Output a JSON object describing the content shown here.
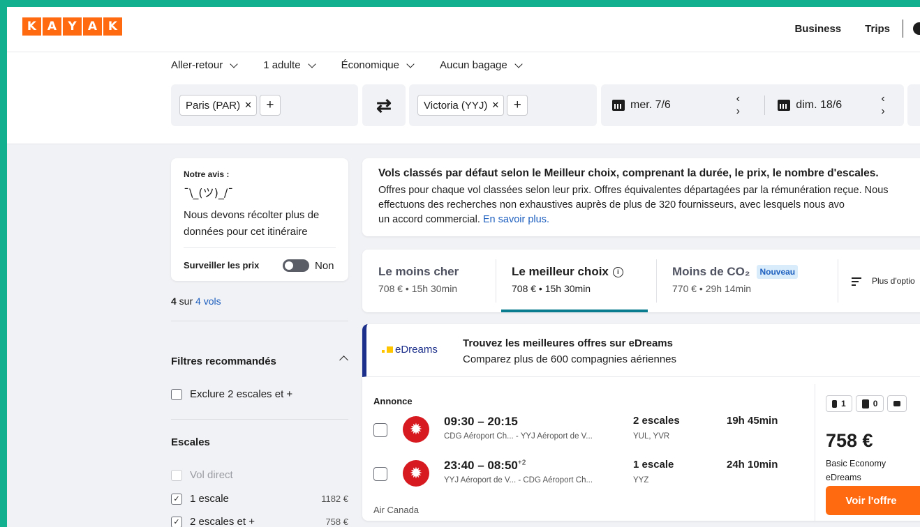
{
  "header": {
    "logo_letters": [
      "K",
      "A",
      "Y",
      "A",
      "K"
    ],
    "nav": {
      "business": "Business",
      "trips": "Trips"
    }
  },
  "search": {
    "options": [
      "Aller-retour",
      "1 adulte",
      "Économique",
      "Aucun bagage"
    ],
    "origin": "Paris (PAR)",
    "destination": "Victoria (YYJ)",
    "depart_date": "mer. 7/6",
    "return_date": "dim. 18/6",
    "remove_glyph": "✕",
    "add_glyph": "+",
    "swap_glyph": "⇄",
    "date_arrows": "‹ ›"
  },
  "advice": {
    "label": "Notre avis :",
    "shrug": "¯\\_(ツ)_/¯",
    "message": "Nous devons récolter plus de données pour cet itinéraire",
    "watch_label": "Surveiller les prix",
    "toggle_state": "Non"
  },
  "results_count": {
    "count": "4",
    "sep": " sur ",
    "total": "4 vols"
  },
  "filters": {
    "recommended_title": "Filtres recommandés",
    "recommended": [
      {
        "label": "Exclure 2 escales et +",
        "checked": false
      }
    ],
    "stops_title": "Escales",
    "stops": [
      {
        "label": "Vol direct",
        "price": "",
        "checked": false,
        "disabled": true
      },
      {
        "label": "1 escale",
        "price": "1182 €",
        "checked": true,
        "disabled": false
      },
      {
        "label": "2 escales et +",
        "price": "758 €",
        "checked": true,
        "disabled": false
      }
    ]
  },
  "info_banner": {
    "title": "Vols classés par défaut selon le Meilleur choix, comprenant la durée, le prix, le nombre d'escales.",
    "body": "Offres pour chaque vol classées selon leur prix. Offres équivalentes départagées par la rémunération reçue. Nous effectuons des recherches non exhaustives auprès de plus de 320 fournisseurs, avec lesquels nous avo",
    "body_end": "un accord commercial. ",
    "link": "En savoir plus."
  },
  "sort_tabs": [
    {
      "name": "Le moins cher",
      "sub": "708 € • 15h 30min",
      "active": false
    },
    {
      "name": "Le meilleur choix",
      "sub": "708 € • 15h 30min",
      "active": true
    },
    {
      "name": "Moins de CO₂",
      "sub": "770 € • 29h 14min",
      "active": false,
      "badge": "Nouveau"
    }
  ],
  "sort_more": "Plus d'optio",
  "info_icon": "i",
  "ad": {
    "brand": "eDreams",
    "headline": "Trouvez les meilleures offres sur eDreams",
    "subline": "Comparez plus de 600 compagnies aériennes",
    "label": "Annonce",
    "airline": "Air Canada",
    "legs": [
      {
        "times": "09:30 – 20:15",
        "day_offset": "",
        "airports": "CDG Aéroport Ch... - YYJ Aéroport de V...",
        "stops": "2 escales",
        "via": "YUL, YVR",
        "duration": "19h 45min"
      },
      {
        "times": "23:40 – 08:50",
        "day_offset": "+2",
        "airports": "YYJ Aéroport de V... - CDG Aéroport Ch...",
        "stops": "1 escale",
        "via": "YYZ",
        "duration": "24h 10min"
      }
    ],
    "bags": [
      "1",
      "0"
    ],
    "price": "758 €",
    "fare": "Basic Economy",
    "provider": "eDreams",
    "cta": "Voir l'offre"
  },
  "colors": {
    "brand": "#ff690f",
    "accent_tab": "#0a7c8f",
    "link": "#1d5fbf",
    "frame": "#13b08f"
  }
}
